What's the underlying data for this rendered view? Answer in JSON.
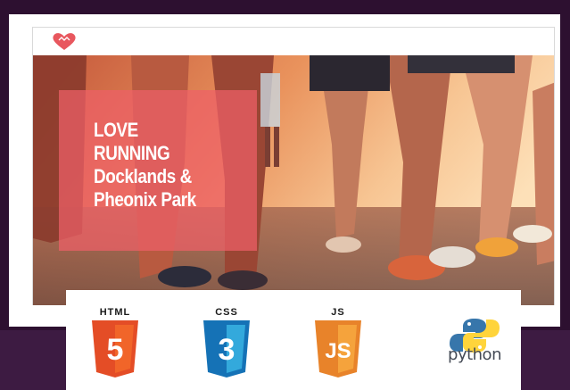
{
  "hero": {
    "title": "LOVE\nRUNNING\nDocklands &\nPheonix Park"
  },
  "site": {
    "logo_icon": "heart-logo-icon"
  },
  "technologies": [
    {
      "label": "HTML",
      "badge": "5",
      "color": "#e44d26",
      "icon": "html5-icon"
    },
    {
      "label": "CSS",
      "badge": "3",
      "color": "#1572b6",
      "icon": "css3-icon"
    },
    {
      "label": "JS",
      "badge": "JS",
      "color": "#f0932a",
      "icon": "js-icon"
    },
    {
      "label": "python",
      "badge": "",
      "color": "#3776ab",
      "icon": "python-icon"
    }
  ]
}
